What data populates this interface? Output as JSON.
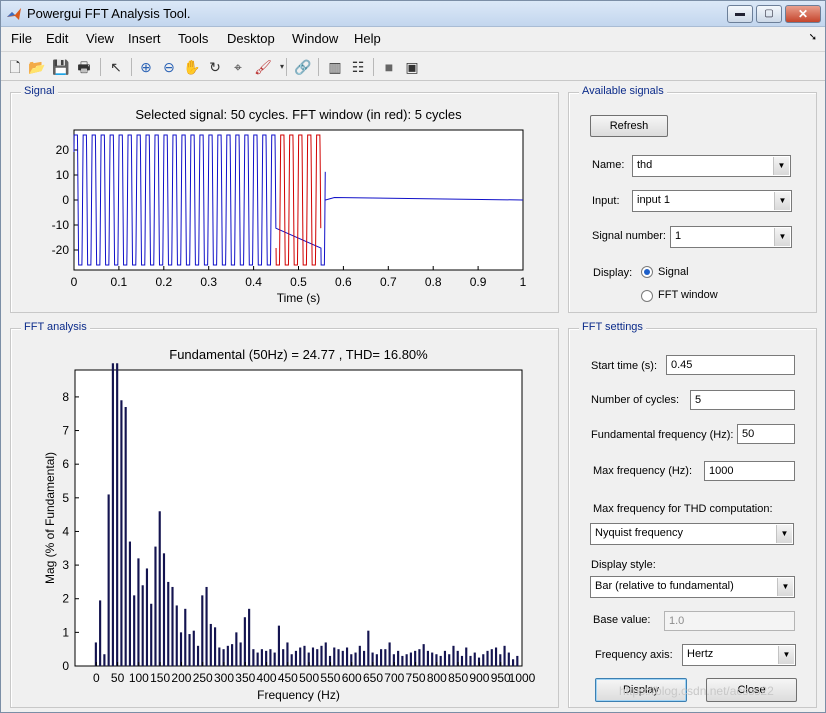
{
  "window": {
    "title": "Powergui FFT Analysis Tool.",
    "minimize": "▬",
    "maximize": "▢",
    "close": "✕"
  },
  "menu": [
    "File",
    "Edit",
    "View",
    "Insert",
    "Tools",
    "Desktop",
    "Window",
    "Help"
  ],
  "toolbar_icons": [
    "new-icon",
    "open-icon",
    "save-icon",
    "print-icon",
    "pointer-icon",
    "zoom-in-icon",
    "zoom-out-icon",
    "pan-icon",
    "rotate-icon",
    "data-cursor-icon",
    "brush-icon",
    "link-icon",
    "colorbar-icon",
    "legend-icon",
    "hide-tools-icon",
    "dock-icon"
  ],
  "signal_panel": {
    "title": "Signal",
    "chart_data": {
      "type": "line",
      "title": "Selected signal: 50 cycles. FFT window (in red): 5 cycles",
      "xlabel": "Time (s)",
      "ylabel": "",
      "xlim": [
        0,
        1
      ],
      "ylim": [
        -28,
        28
      ],
      "xticks": [
        "0",
        "0.1",
        "0.2",
        "0.3",
        "0.4",
        "0.5",
        "0.6",
        "0.7",
        "0.8",
        "0.9",
        "1"
      ],
      "yticks": [
        "20",
        "10",
        "0",
        "-10",
        "-20"
      ],
      "amplitude": 26,
      "frequency_hz": 50,
      "signal_end_s": 0.56,
      "fft_window_s": [
        0.45,
        0.55
      ],
      "colors": {
        "signal": "#1010c8",
        "fft_window": "#d00000"
      }
    }
  },
  "available_signals": {
    "title": "Available signals",
    "refresh": "Refresh",
    "name_label": "Name:",
    "name_value": "thd",
    "input_label": "Input:",
    "input_value": "input 1",
    "signal_number_label": "Signal number:",
    "signal_number_value": "1",
    "display_label": "Display:",
    "opt_signal": "Signal",
    "opt_fft": "FFT window"
  },
  "fft_panel": {
    "title": "FFT analysis",
    "chart_data": {
      "type": "bar",
      "title": "Fundamental (50Hz) = 24.77 , THD= 16.80%",
      "xlabel": "Frequency (Hz)",
      "ylabel": "Mag (% of Fundamental)",
      "xlim": [
        -50,
        1000
      ],
      "ylim": [
        0,
        8.8
      ],
      "xticks": [
        "0",
        "50",
        "100",
        "150",
        "200",
        "250",
        "300",
        "350",
        "400",
        "450",
        "500",
        "550",
        "600",
        "650",
        "700",
        "750",
        "800",
        "850",
        "900",
        "950",
        "1000"
      ],
      "yticks": [
        "0",
        "1",
        "2",
        "3",
        "4",
        "5",
        "6",
        "7",
        "8"
      ],
      "bar_width_hz": 7,
      "bars": [
        [
          0,
          0.7
        ],
        [
          10,
          1.95
        ],
        [
          20,
          0.35
        ],
        [
          30,
          5.1
        ],
        [
          40,
          9
        ],
        [
          50,
          9
        ],
        [
          60,
          7.9
        ],
        [
          70,
          7.7
        ],
        [
          80,
          3.7
        ],
        [
          90,
          2.1
        ],
        [
          100,
          3.2
        ],
        [
          110,
          2.4
        ],
        [
          120,
          2.9
        ],
        [
          130,
          1.85
        ],
        [
          140,
          3.55
        ],
        [
          150,
          4.6
        ],
        [
          160,
          3.35
        ],
        [
          170,
          2.5
        ],
        [
          180,
          2.35
        ],
        [
          190,
          1.8
        ],
        [
          200,
          1.0
        ],
        [
          210,
          1.7
        ],
        [
          220,
          0.95
        ],
        [
          230,
          1.05
        ],
        [
          240,
          0.6
        ],
        [
          250,
          2.1
        ],
        [
          260,
          2.35
        ],
        [
          270,
          1.25
        ],
        [
          280,
          1.15
        ],
        [
          290,
          0.55
        ],
        [
          300,
          0.5
        ],
        [
          310,
          0.6
        ],
        [
          320,
          0.65
        ],
        [
          330,
          1.0
        ],
        [
          340,
          0.7
        ],
        [
          350,
          1.45
        ],
        [
          360,
          1.7
        ],
        [
          370,
          0.5
        ],
        [
          380,
          0.4
        ],
        [
          390,
          0.5
        ],
        [
          400,
          0.45
        ],
        [
          410,
          0.5
        ],
        [
          420,
          0.4
        ],
        [
          430,
          1.2
        ],
        [
          440,
          0.5
        ],
        [
          450,
          0.7
        ],
        [
          460,
          0.35
        ],
        [
          470,
          0.45
        ],
        [
          480,
          0.55
        ],
        [
          490,
          0.6
        ],
        [
          500,
          0.4
        ],
        [
          510,
          0.55
        ],
        [
          520,
          0.5
        ],
        [
          530,
          0.6
        ],
        [
          540,
          0.7
        ],
        [
          550,
          0.3
        ],
        [
          560,
          0.55
        ],
        [
          570,
          0.5
        ],
        [
          580,
          0.45
        ],
        [
          590,
          0.55
        ],
        [
          600,
          0.35
        ],
        [
          610,
          0.4
        ],
        [
          620,
          0.6
        ],
        [
          630,
          0.45
        ],
        [
          640,
          1.05
        ],
        [
          650,
          0.4
        ],
        [
          660,
          0.35
        ],
        [
          670,
          0.5
        ],
        [
          680,
          0.5
        ],
        [
          690,
          0.7
        ],
        [
          700,
          0.35
        ],
        [
          710,
          0.45
        ],
        [
          720,
          0.3
        ],
        [
          730,
          0.35
        ],
        [
          740,
          0.4
        ],
        [
          750,
          0.45
        ],
        [
          760,
          0.5
        ],
        [
          770,
          0.65
        ],
        [
          780,
          0.45
        ],
        [
          790,
          0.4
        ],
        [
          800,
          0.35
        ],
        [
          810,
          0.3
        ],
        [
          820,
          0.45
        ],
        [
          830,
          0.35
        ],
        [
          840,
          0.6
        ],
        [
          850,
          0.45
        ],
        [
          860,
          0.3
        ],
        [
          870,
          0.55
        ],
        [
          880,
          0.3
        ],
        [
          890,
          0.4
        ],
        [
          900,
          0.25
        ],
        [
          910,
          0.35
        ],
        [
          920,
          0.45
        ],
        [
          930,
          0.5
        ],
        [
          940,
          0.55
        ],
        [
          950,
          0.35
        ],
        [
          960,
          0.6
        ],
        [
          970,
          0.4
        ],
        [
          980,
          0.2
        ],
        [
          990,
          0.3
        ]
      ],
      "colors": {
        "bar": "#141450"
      }
    }
  },
  "fft_settings": {
    "title": "FFT settings",
    "start_time_label": "Start time (s):",
    "start_time_value": "0.45",
    "cycles_label": "Number of cycles:",
    "cycles_value": "5",
    "fund_freq_label": "Fundamental frequency (Hz):",
    "fund_freq_value": "50",
    "max_freq_label": "Max frequency (Hz):",
    "max_freq_value": "1000",
    "thd_label": "Max frequency for THD computation:",
    "thd_value": "Nyquist frequency",
    "style_label": "Display style:",
    "style_value": "Bar (relative to fundamental)",
    "base_label": "Base value:",
    "base_value": "1.0",
    "axis_label": "Frequency axis:",
    "axis_value": "Hertz",
    "display_button": "Display",
    "close_button": "Close"
  },
  "watermark": "https://blog.csdn.net/acsss22"
}
